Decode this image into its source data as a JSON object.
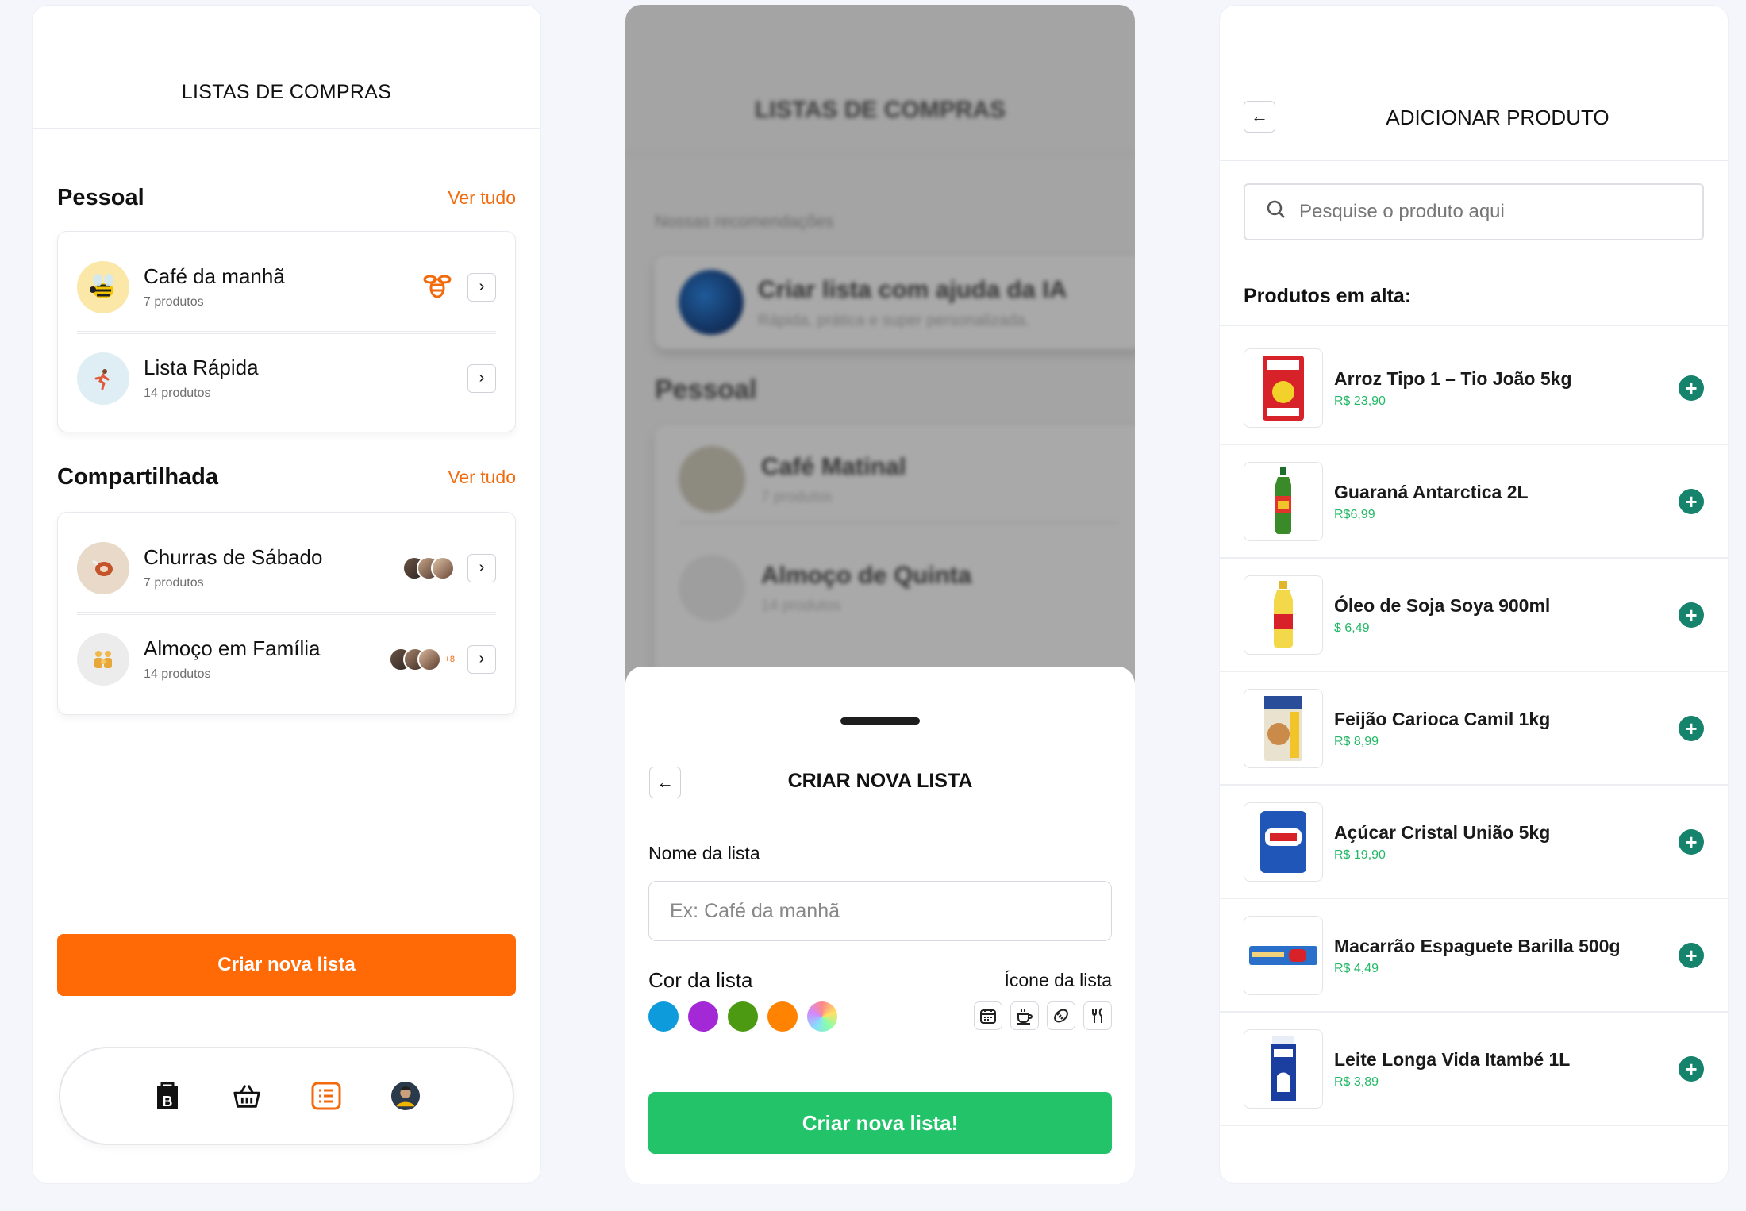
{
  "screen1": {
    "header_title": "LISTAS DE COMPRAS",
    "personal": {
      "title": "Pessoal",
      "see_all": "Ver tudo",
      "items": [
        {
          "name": "Café da manhã",
          "count": "7 produtos",
          "avatar_icon": "bee-icon",
          "badge_icon": "bee-badge-icon"
        },
        {
          "name": "Lista Rápida",
          "count": "14 produtos",
          "avatar_icon": "runner-icon"
        }
      ]
    },
    "shared": {
      "title": "Compartilhada",
      "see_all": "Ver tudo",
      "items": [
        {
          "name": "Churras de Sábado",
          "count": "7 produtos",
          "avatar_icon": "meat-icon"
        },
        {
          "name": "Almoço em Família",
          "count": "14 produtos",
          "avatar_icon": "family-icon",
          "more": "+8"
        }
      ]
    },
    "create_button": "Criar nova lista",
    "nav_icons": [
      "shop-bag-icon",
      "basket-icon",
      "list-icon",
      "profile-avatar"
    ]
  },
  "screen2": {
    "background": {
      "header_title": "LISTAS DE COMPRAS",
      "recommendations": "Nossas recomendações",
      "ai_title": "Criar lista com ajuda da IA",
      "ai_sub": "Rápida, prática e super personalizada.",
      "section": "Pessoal",
      "items": [
        {
          "name": "Café Matinal",
          "count": "7 produtos"
        },
        {
          "name": "Almoço de Quinta",
          "count": "14 produtos"
        }
      ]
    },
    "sheet": {
      "title": "CRIAR NOVA LISTA",
      "name_label": "Nome da lista",
      "name_placeholder": "Ex: Café da manhã",
      "color_label": "Cor da lista",
      "icon_label": "Ícone da lista",
      "colors": [
        "#0e9bdc",
        "#a429d6",
        "#4c9a12",
        "#ff8200",
        "rainbow"
      ],
      "icons": [
        "calendar-icon",
        "coffee-icon",
        "bread-icon",
        "cutlery-icon"
      ],
      "submit": "Criar nova lista!"
    }
  },
  "screen3": {
    "header_title": "ADICIONAR PRODUTO",
    "search_placeholder": "Pesquise o produto aqui",
    "trending_title": "Produtos em alta:",
    "products": [
      {
        "name": "Arroz Tipo 1 – Tio João 5kg",
        "price": "R$ 23,90"
      },
      {
        "name": "Guaraná Antarctica 2L",
        "price": "R$6,99"
      },
      {
        "name": "Óleo de Soja Soya 900ml",
        "price": "$ 6,49"
      },
      {
        "name": "Feijão Carioca Camil 1kg",
        "price": "R$ 8,99"
      },
      {
        "name": "Açúcar Cristal União 5kg",
        "price": "R$ 19,90"
      },
      {
        "name": "Macarrão Espaguete Barilla 500g",
        "price": "R$ 4,49"
      },
      {
        "name": "Leite Longa Vida Itambé 1L",
        "price": "R$ 3,89"
      }
    ],
    "add_label": "+"
  }
}
